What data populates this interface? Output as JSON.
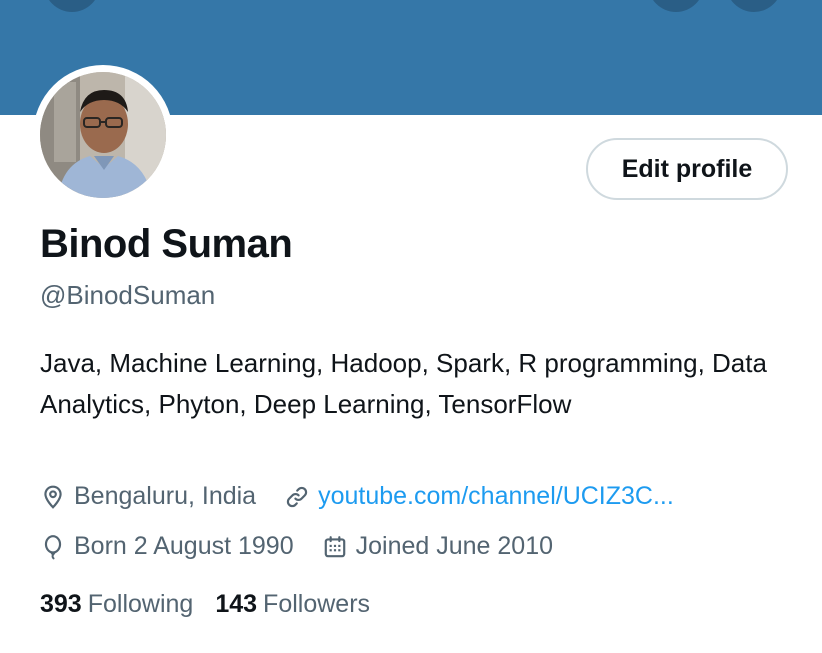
{
  "profile": {
    "name": "Binod Suman",
    "handle": "@BinodSuman",
    "bio": "Java, Machine Learning, Hadoop, Spark, R programming, Data Analytics, Phyton, Deep Learning, TensorFlow",
    "location": "Bengaluru, India",
    "website": "youtube.com/channel/UCIZ3C...",
    "birthday": "Born 2 August 1990",
    "joined": "Joined June 2010"
  },
  "actions": {
    "edit_profile_label": "Edit profile"
  },
  "stats": {
    "following_count": "393",
    "following_label": "Following",
    "followers_count": "143",
    "followers_label": "Followers"
  },
  "icons": {
    "location": "location-pin-icon",
    "website": "link-icon",
    "birthday": "balloon-icon",
    "joined": "calendar-icon"
  },
  "colors": {
    "banner": "#3577a8",
    "link": "#1d9bf0",
    "secondary_text": "#536471",
    "primary_text": "#0f1419",
    "button_border": "#cfd9de"
  }
}
